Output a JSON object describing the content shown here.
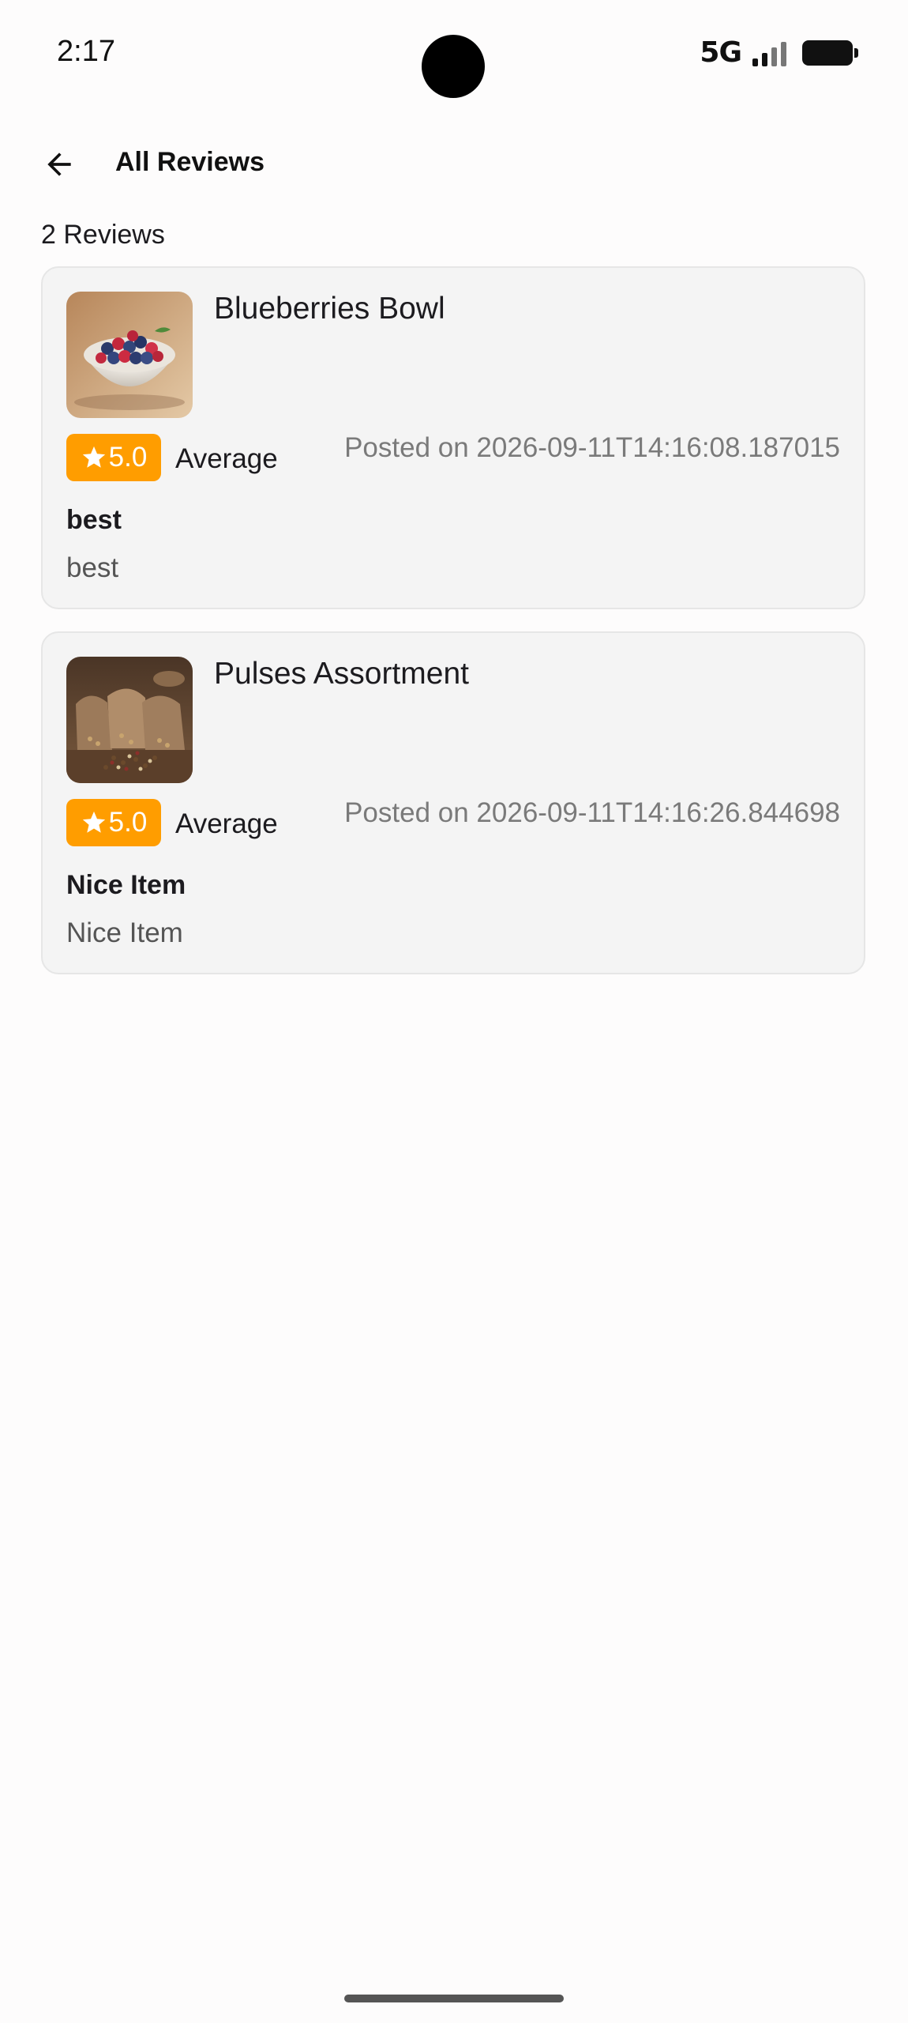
{
  "status_bar": {
    "time": "2:17",
    "network": "5G",
    "icons": [
      "signal-icon",
      "battery-icon"
    ]
  },
  "app_bar": {
    "title": "All Reviews",
    "back_icon": "arrow-back-icon"
  },
  "review_count": "2 Reviews",
  "colors": {
    "rating_badge": "#ff9d00",
    "card_background": "#f4f4f4",
    "card_border": "#e6e6e6",
    "page_background": "#fdfcfc"
  },
  "reviews": [
    {
      "product_name": "Blueberries Bowl",
      "image_icon": "blueberries-bowl-image",
      "rating": "5.0",
      "rating_label": "Average",
      "posted": "Posted on 2026-09-11T14:16:08.187015",
      "title": "best",
      "body": "best"
    },
    {
      "product_name": "Pulses Assortment",
      "image_icon": "pulses-assortment-image",
      "rating": "5.0",
      "rating_label": "Average",
      "posted": "Posted on 2026-09-11T14:16:26.844698",
      "title": "Nice Item",
      "body": "Nice Item"
    }
  ]
}
